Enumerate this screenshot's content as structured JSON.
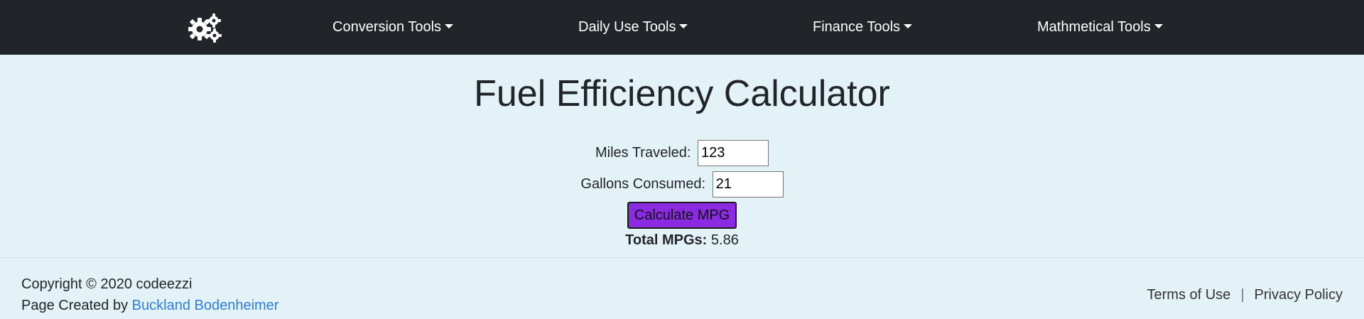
{
  "nav": {
    "logo_icon": "gears-icon",
    "items": [
      {
        "label": "Conversion Tools"
      },
      {
        "label": "Daily Use Tools"
      },
      {
        "label": "Finance Tools"
      },
      {
        "label": "Mathmetical Tools"
      }
    ]
  },
  "page": {
    "title": "Fuel Efficiency Calculator"
  },
  "form": {
    "miles_label": "Miles Traveled:",
    "miles_value": "123",
    "gallons_label": "Gallons Consumed:",
    "gallons_value": "21",
    "button_label": "Calculate MPG",
    "button_color": "#8a2be2"
  },
  "result": {
    "label": "Total MPGs:",
    "value": "5.86"
  },
  "footer": {
    "copyright": "Copyright © 2020 codeezzi",
    "credit_prefix": "Page Created by",
    "credit_name": "Buckland Bodenheimer",
    "terms": "Terms of Use",
    "separator": "|",
    "privacy": "Privacy Policy"
  },
  "colors": {
    "navbar_bg": "#212529",
    "page_bg": "#e3f2f7",
    "link": "#2f7fd8"
  }
}
